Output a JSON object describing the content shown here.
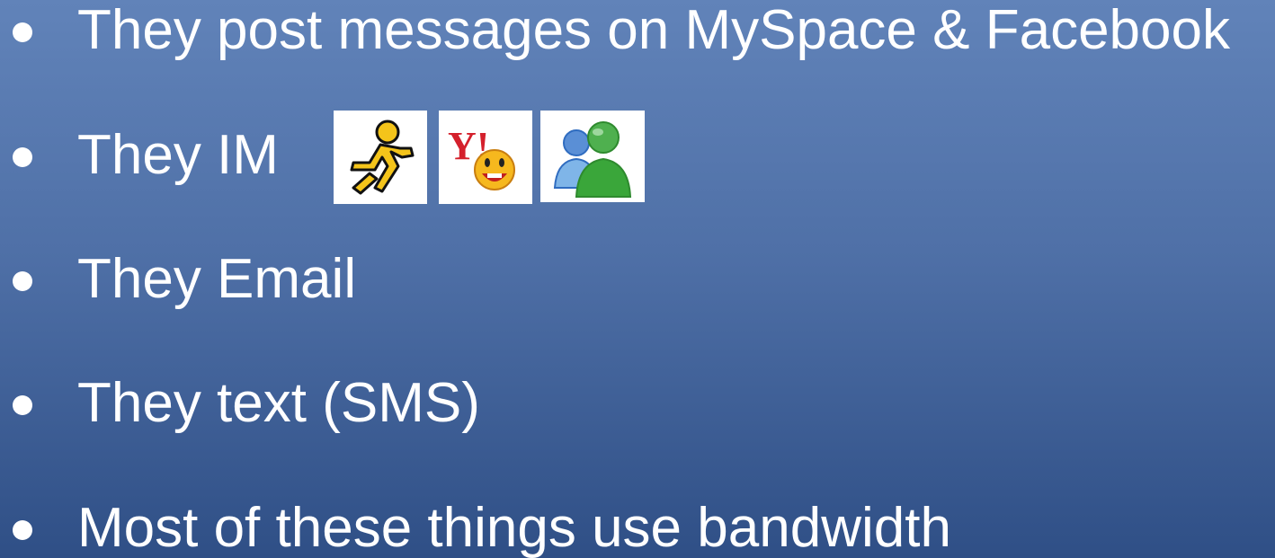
{
  "slide": {
    "bullets": [
      {
        "text": "They post messages on MySpace & Facebook"
      },
      {
        "text": "They IM"
      },
      {
        "text": "They Email"
      },
      {
        "text": "They text (SMS)"
      },
      {
        "text": "Most of these things use bandwidth"
      }
    ],
    "im_icons": [
      {
        "icon": "aim-running-man-icon"
      },
      {
        "icon": "yahoo-messenger-icon",
        "brand_text": "Y!"
      },
      {
        "icon": "msn-messenger-icon"
      }
    ]
  },
  "colors": {
    "background_top": "#6183b9",
    "background_bottom": "#2f4f86",
    "text": "#ffffff",
    "aim_yellow": "#f4c41a",
    "yahoo_red": "#d4202c",
    "msn_blue": "#2f6cc0",
    "msn_green": "#3aa63a"
  }
}
